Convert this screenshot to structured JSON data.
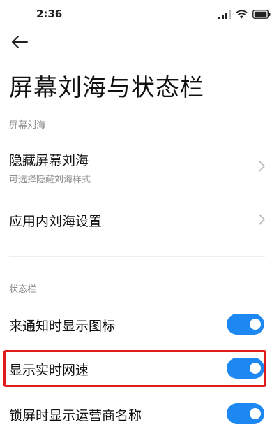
{
  "status_bar": {
    "time": "2:36",
    "icons": [
      "signal-icon",
      "wifi-icon",
      "battery-icon"
    ]
  },
  "nav": {
    "back_icon": "arrow-left-icon"
  },
  "page": {
    "title": "屏幕刘海与状态栏"
  },
  "sections": {
    "notch": {
      "header": "屏幕刘海",
      "items": [
        {
          "title": "隐藏屏幕刘海",
          "subtitle": "可选择隐藏刘海样式"
        },
        {
          "title": "应用内刘海设置"
        }
      ]
    },
    "status_bar": {
      "header": "状态栏",
      "items": [
        {
          "title": "来通知时显示图标",
          "enabled": true
        },
        {
          "title": "显示实时网速",
          "enabled": true,
          "highlighted": true
        },
        {
          "title": "锁屏时显示运营商名称",
          "enabled": true
        }
      ]
    }
  },
  "colors": {
    "toggle_on": "#1e88f2",
    "highlight": "#e11b1b",
    "section_header": "#8a8a8a"
  }
}
